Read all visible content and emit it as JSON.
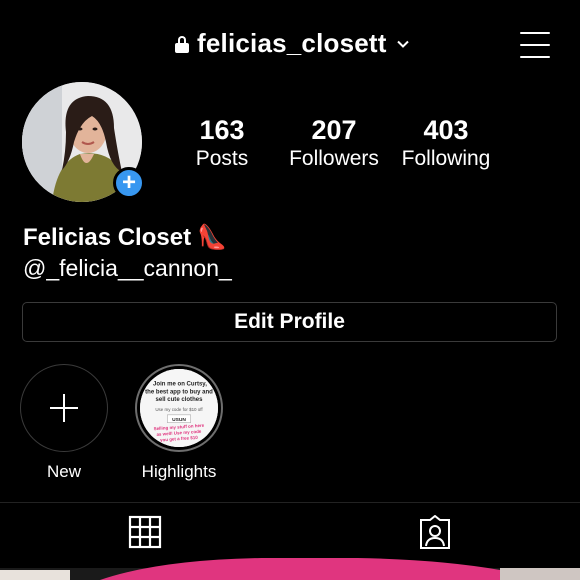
{
  "header": {
    "username": "felicias_closett"
  },
  "profile": {
    "display_name": "Felicias Closet",
    "name_emoji": "👠",
    "handle": "@_felicia__cannon_",
    "add_story_symbol": "+"
  },
  "stats": [
    {
      "value": "163",
      "label": "Posts"
    },
    {
      "value": "207",
      "label": "Followers"
    },
    {
      "value": "403",
      "label": "Following"
    }
  ],
  "edit_profile_label": "Edit Profile",
  "highlights": [
    {
      "label": "New"
    },
    {
      "label": "Highlights",
      "cover_text": {
        "line1": "Join me on Curtsy,",
        "line2": "the best app to buy and",
        "line3": "sell cute clothes",
        "line4": "Use my code for $10 off",
        "code": "USUN",
        "pink1": "Selling my stuff on here",
        "pink2": "as well! Use my code",
        "pink3": "you get a free $10"
      }
    }
  ],
  "tabs": [
    {
      "name": "grid",
      "icon": "grid-icon"
    },
    {
      "name": "tagged",
      "icon": "tagged-person-icon"
    }
  ],
  "colors": {
    "background": "#000000",
    "accent_blue": "#3897f0",
    "highlight_pink": "#e0357f"
  }
}
